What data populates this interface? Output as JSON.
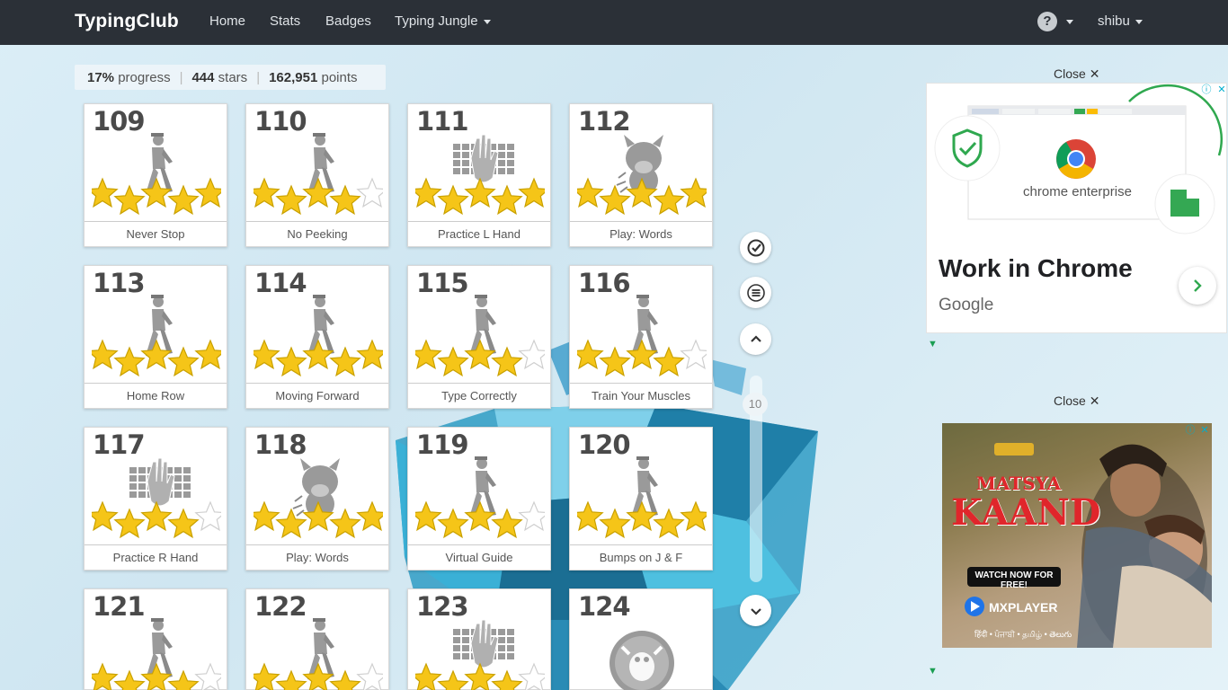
{
  "nav": {
    "brand": "TypingClub",
    "home": "Home",
    "stats": "Stats",
    "badges": "Badges",
    "jungle": "Typing Jungle",
    "help": "?",
    "user": "shibu"
  },
  "progress": {
    "percent": "17%",
    "percent_label": "progress",
    "stars": "444",
    "stars_label": "stars",
    "points": "162,951",
    "points_label": "points"
  },
  "lessons": [
    {
      "num": "109",
      "label": "Never Stop",
      "art": "walker",
      "stars": 5
    },
    {
      "num": "110",
      "label": "No Peeking",
      "art": "walker",
      "stars": 4
    },
    {
      "num": "111",
      "label": "Practice L Hand",
      "art": "keyboard",
      "stars": 5
    },
    {
      "num": "112",
      "label": "Play: Words",
      "art": "monster",
      "stars": 5
    },
    {
      "num": "113",
      "label": "Home Row",
      "art": "walker",
      "stars": 5
    },
    {
      "num": "114",
      "label": "Moving Forward",
      "art": "walker",
      "stars": 5
    },
    {
      "num": "115",
      "label": "Type Correctly",
      "art": "walker",
      "stars": 4
    },
    {
      "num": "116",
      "label": "Train Your Muscles",
      "art": "walker",
      "stars": 4
    },
    {
      "num": "117",
      "label": "Practice R Hand",
      "art": "keyboard",
      "stars": 4
    },
    {
      "num": "118",
      "label": "Play: Words",
      "art": "monster",
      "stars": 5
    },
    {
      "num": "119",
      "label": "Virtual Guide",
      "art": "walker",
      "stars": 4
    },
    {
      "num": "120",
      "label": "Bumps on J & F",
      "art": "walker",
      "stars": 5
    },
    {
      "num": "121",
      "label": "",
      "art": "walker",
      "stars": 4
    },
    {
      "num": "122",
      "label": "",
      "art": "walker",
      "stars": 4
    },
    {
      "num": "123",
      "label": "",
      "art": "keyboard",
      "stars": 4
    },
    {
      "num": "124",
      "label": "",
      "art": "badge",
      "stars": 0
    }
  ],
  "scroll": {
    "page": "10"
  },
  "ads": {
    "close_label": "Close",
    "close_x": "✕",
    "ad1": {
      "headline": "Work in Chrome",
      "advertiser": "Google",
      "product": "chrome enterprise"
    },
    "ad2": {
      "title_line1": "MATSYA",
      "title_line2": "KAAND",
      "cta": "WATCH NOW FOR FREE!",
      "platform": "MXPLAYER",
      "languages": "हिंदी • ਪੰਜਾਬੀ • தமிழ் • తెలుగు"
    }
  },
  "colors": {
    "navbar": "#2b3037",
    "star": "#f5c518",
    "art_gray": "#9a9a9a"
  }
}
